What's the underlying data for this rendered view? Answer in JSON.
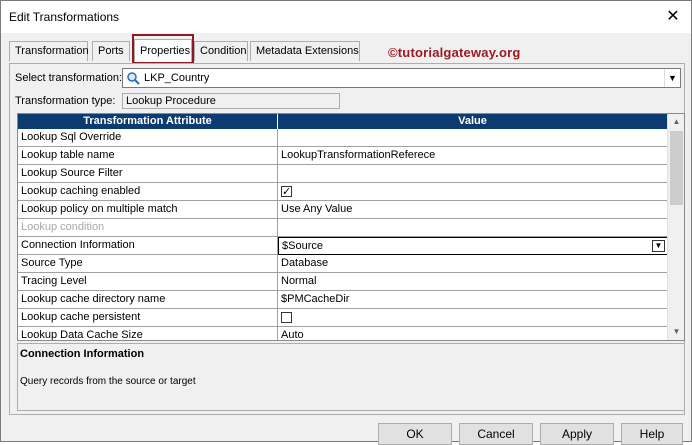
{
  "window": {
    "title": "Edit Transformations",
    "close_glyph": "✕"
  },
  "tabs": [
    {
      "label": "Transformation"
    },
    {
      "label": "Ports"
    },
    {
      "label": "Properties",
      "active": true
    },
    {
      "label": "Condition"
    },
    {
      "label": "Metadata Extensions"
    }
  ],
  "watermark": "©tutorialgateway.org",
  "select_transformation": {
    "label": "Select transformation:",
    "value": "LKP_Country",
    "icon": "lookup-icon"
  },
  "transformation_type": {
    "label": "Transformation type:",
    "value": "Lookup Procedure"
  },
  "grid": {
    "headers": {
      "attribute": "Transformation Attribute",
      "value": "Value"
    },
    "rows": [
      {
        "attribute": "Lookup Sql Override",
        "value": ""
      },
      {
        "attribute": "Lookup table name",
        "value": "LookupTransformationReferece"
      },
      {
        "attribute": "Lookup Source Filter",
        "value": ""
      },
      {
        "attribute": "Lookup caching enabled",
        "value": "",
        "checkbox": true,
        "checked": true
      },
      {
        "attribute": "Lookup policy on multiple match",
        "value": "Use Any Value"
      },
      {
        "attribute": "Lookup condition",
        "value": "",
        "disabled": true
      },
      {
        "attribute": "Connection Information",
        "value": "$Source",
        "selected": true,
        "dropdown": true
      },
      {
        "attribute": "Source Type",
        "value": "Database"
      },
      {
        "attribute": "Tracing Level",
        "value": "Normal"
      },
      {
        "attribute": "Lookup cache directory name",
        "value": "$PMCacheDir"
      },
      {
        "attribute": "Lookup cache persistent",
        "value": "",
        "checkbox": true,
        "checked": false
      },
      {
        "attribute": "Lookup Data Cache Size",
        "value": "Auto"
      }
    ]
  },
  "description": {
    "title": "Connection Information",
    "text": "Query records from the source or target"
  },
  "buttons": {
    "ok": "OK",
    "cancel": "Cancel",
    "apply": "Apply",
    "help": "Help"
  },
  "colors": {
    "grid_header": "#0b3b71",
    "watermark": "#9c1a22"
  }
}
